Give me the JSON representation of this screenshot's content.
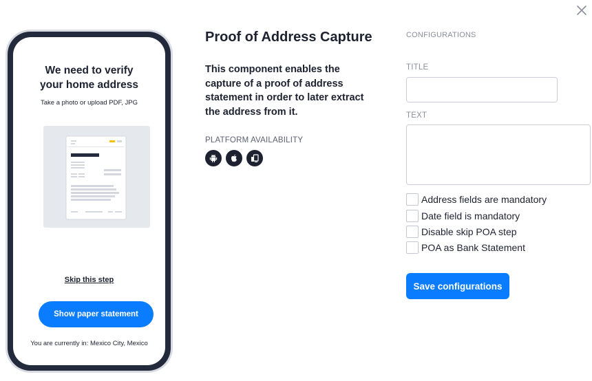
{
  "close": {
    "icon": "close-icon"
  },
  "phone": {
    "title_line1": "We need to verify",
    "title_line2": "your home address",
    "subtitle": "Take a photo or upload PDF, JPG",
    "illustration_icon": "document-icon",
    "skip_link": "Skip this step",
    "primary_button": "Show paper statement",
    "location_text": "You are currently in: Mexico City, Mexico"
  },
  "info": {
    "title": "Proof of Address Capture",
    "description": "This component enables the capture of a proof of address statement in order to later extract the address from it.",
    "platform_label": "PLATFORM AVAILABILITY",
    "platforms": [
      "android-icon",
      "apple-icon",
      "web-icon"
    ]
  },
  "config": {
    "header": "CONFIGURATIONS",
    "title_label": "TITLE",
    "title_value": "",
    "text_label": "TEXT",
    "text_value": "",
    "checkboxes": [
      {
        "label": "Address fields are mandatory",
        "checked": false
      },
      {
        "label": "Date field is mandatory",
        "checked": false
      },
      {
        "label": "Disable skip POA step",
        "checked": false
      },
      {
        "label": "POA as Bank Statement",
        "checked": false
      }
    ],
    "save_button": "Save configurations"
  },
  "colors": {
    "accent": "#0a7cff",
    "text_dark": "#1d2130",
    "muted": "#8a8f9c",
    "phone_frame": "#232a3b"
  }
}
